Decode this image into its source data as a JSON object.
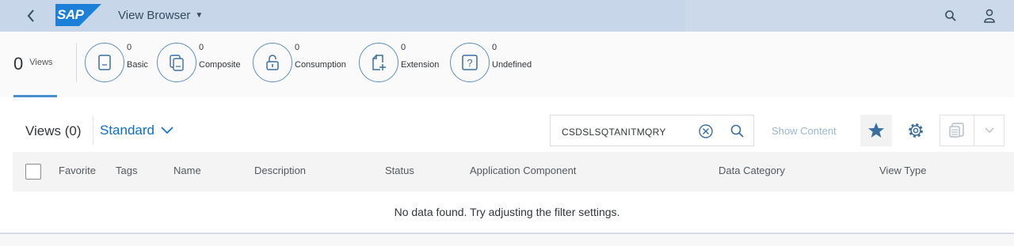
{
  "shell": {
    "logo_text": "SAP",
    "app_title": "View Browser",
    "icons": [
      "back-icon",
      "search-icon",
      "user-icon"
    ],
    "colors": {
      "shell_bg": "#c7d6e8",
      "logo_blue": "#1c7fd8"
    }
  },
  "summary": {
    "total_count": "0",
    "total_label": "Views",
    "tiles": [
      {
        "count": "0",
        "label": "Basic",
        "icon": "document-icon"
      },
      {
        "count": "0",
        "label": "Composite",
        "icon": "stacked-documents-icon"
      },
      {
        "count": "0",
        "label": "Consumption",
        "icon": "unlock-icon"
      },
      {
        "count": "0",
        "label": "Extension",
        "icon": "add-document-icon"
      },
      {
        "count": "0",
        "label": "Undefined",
        "icon": "question-mark-icon"
      }
    ]
  },
  "toolbar": {
    "title": "Views (0)",
    "variant": "Standard",
    "search_value": "CSDSLSQTANITMQRY",
    "show_content": "Show Content",
    "icons": [
      "clear-icon",
      "search-icon",
      "favorite-star-icon",
      "settings-gear-icon",
      "export-icon",
      "chevron-down-icon"
    ]
  },
  "table": {
    "columns": [
      "Favorite",
      "Tags",
      "Name",
      "Description",
      "Status",
      "Application Component",
      "Data Category",
      "View Type"
    ],
    "rows": [],
    "empty_text": "No data found. Try adjusting the filter settings."
  }
}
